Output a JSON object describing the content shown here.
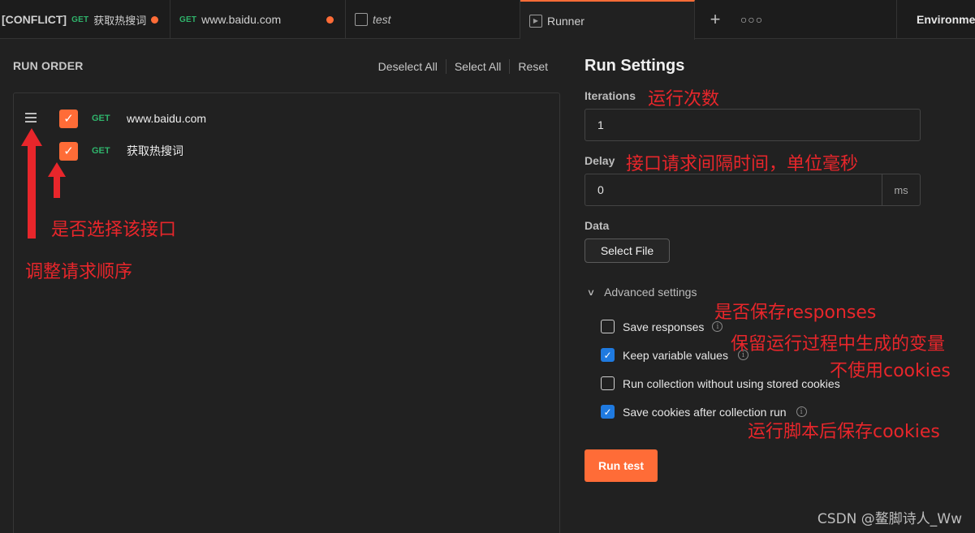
{
  "tabs": [
    {
      "conflict": "[CONFLICT]",
      "method": "GET",
      "label": "获取热搜词"
    },
    {
      "method": "GET",
      "label": "www.baidu.com"
    },
    {
      "label": "test"
    },
    {
      "label": "Runner"
    }
  ],
  "env_label": "Environment",
  "run_order": {
    "title": "RUN ORDER",
    "deselect_all": "Deselect All",
    "select_all": "Select All",
    "reset": "Reset",
    "requests": [
      {
        "method": "GET",
        "name": "www.baidu.com",
        "checked": true
      },
      {
        "method": "GET",
        "name": "获取热搜词",
        "checked": true
      }
    ]
  },
  "settings": {
    "title": "Run Settings",
    "iterations_label": "Iterations",
    "iterations_value": "1",
    "delay_label": "Delay",
    "delay_value": "0",
    "delay_unit": "ms",
    "data_label": "Data",
    "select_file": "Select File",
    "advanced_label": "Advanced settings",
    "options": [
      {
        "label": "Save responses",
        "checked": false,
        "info": true
      },
      {
        "label": "Keep variable values",
        "checked": true,
        "info": true
      },
      {
        "label": "Run collection without using stored cookies",
        "checked": false,
        "info": false
      },
      {
        "label": "Save cookies after collection run",
        "checked": true,
        "info": true
      }
    ],
    "run_button": "Run test"
  },
  "annotations": {
    "iterations": "运行次数",
    "delay": "接口请求间隔时间，单位毫秒",
    "select_api": "是否选择该接口",
    "reorder": "调整请求顺序",
    "save_responses": "是否保存responses",
    "keep_vars": "保留运行过程中生成的变量",
    "no_cookies": "不使用cookies",
    "save_cookies": "运行脚本后保存cookies"
  },
  "watermark": "CSDN @鳌脚诗人_Ww",
  "colors": {
    "accent": "#ff6c37",
    "checkbox_blue": "#1f7ae0",
    "method_get": "#2fb36b",
    "annotation": "#e8262b"
  }
}
